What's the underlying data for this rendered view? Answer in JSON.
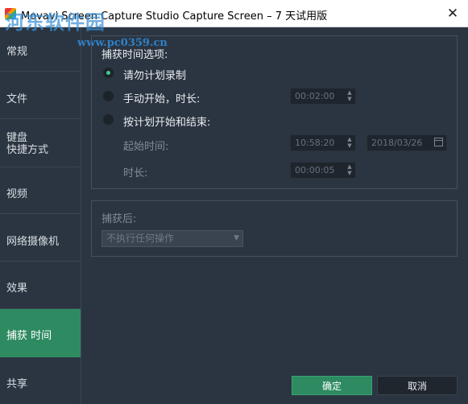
{
  "window": {
    "title": "Movavi Screen Capture Studio Capture Screen – 7 天试用版",
    "close_glyph": "✕"
  },
  "watermark": {
    "text": "河东软件园",
    "url": "www.pc0359.cn"
  },
  "sidebar": {
    "items": [
      {
        "label": "常规"
      },
      {
        "label": "文件"
      },
      {
        "label": "键盘\n快捷方式"
      },
      {
        "label": "视频"
      },
      {
        "label": "网络摄像机"
      },
      {
        "label": "效果"
      },
      {
        "label": "捕获 时间"
      },
      {
        "label": "共享"
      }
    ],
    "active_index": 6
  },
  "capture_time": {
    "heading": "捕获时间选项:",
    "options": [
      {
        "label": "请勿计划录制",
        "checked": true
      },
      {
        "label": "手动开始，时长:",
        "checked": false
      },
      {
        "label": "按计划开始和结束:",
        "checked": false
      }
    ],
    "manual_duration": "00:02:00",
    "start_time_label": "起始时间:",
    "start_time": "10:58:20",
    "start_date": "2018/03/26",
    "duration_label": "时长:",
    "duration": "00:00:05"
  },
  "after_capture": {
    "heading": "捕获后:",
    "selected": "不执行任何操作"
  },
  "buttons": {
    "ok": "确定",
    "cancel": "取消"
  },
  "colors": {
    "accent": "#2e8b61",
    "background": "#2b3541",
    "radio_dot": "#3ec98e"
  },
  "icons": {
    "spin_up": "▲",
    "spin_down": "▼",
    "select_caret": "▼"
  }
}
